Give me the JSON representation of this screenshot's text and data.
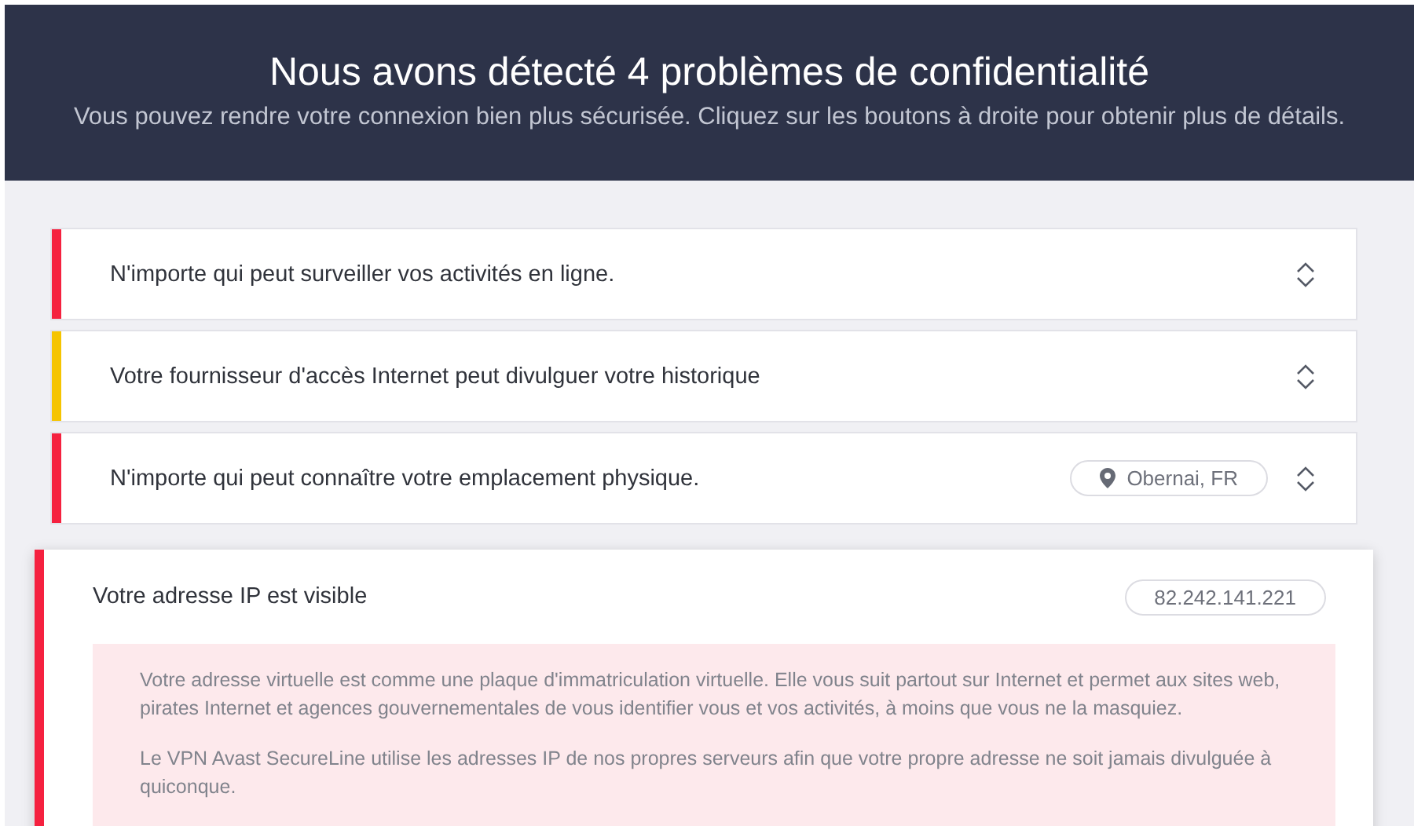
{
  "header": {
    "title": "Nous avons détecté 4 problèmes de confidentialité",
    "subtitle": "Vous pouvez rendre votre connexion bien plus sécurisée. Cliquez sur les boutons à droite pour obtenir plus de détails."
  },
  "issues": [
    {
      "title": "N'importe qui peut surveiller vos activités en ligne.",
      "color": "#f5213f",
      "expanded": false
    },
    {
      "title": "Votre fournisseur d'accès Internet peut divulguer votre historique",
      "color": "#f5c400",
      "expanded": false
    },
    {
      "title": "N'importe qui peut connaître votre emplacement physique.",
      "color": "#f5213f",
      "expanded": false,
      "badge": {
        "kind": "location",
        "text": "Obernai, FR"
      }
    },
    {
      "title": "Votre adresse IP est visible",
      "color": "#f5213f",
      "expanded": true,
      "badge": {
        "kind": "ip",
        "text": "82.242.141.221"
      },
      "details": [
        "Votre adresse virtuelle est comme une plaque d'immatriculation virtuelle. Elle vous suit partout sur Internet et permet aux sites web, pirates Internet et agences gouvernementales de vous identifier vous et vos activités, à moins que vous ne la masquiez.",
        "Le VPN Avast SecureLine utilise les adresses IP de nos propres serveurs afin que votre propre adresse ne soit jamais divulguée à quiconque."
      ]
    }
  ]
}
